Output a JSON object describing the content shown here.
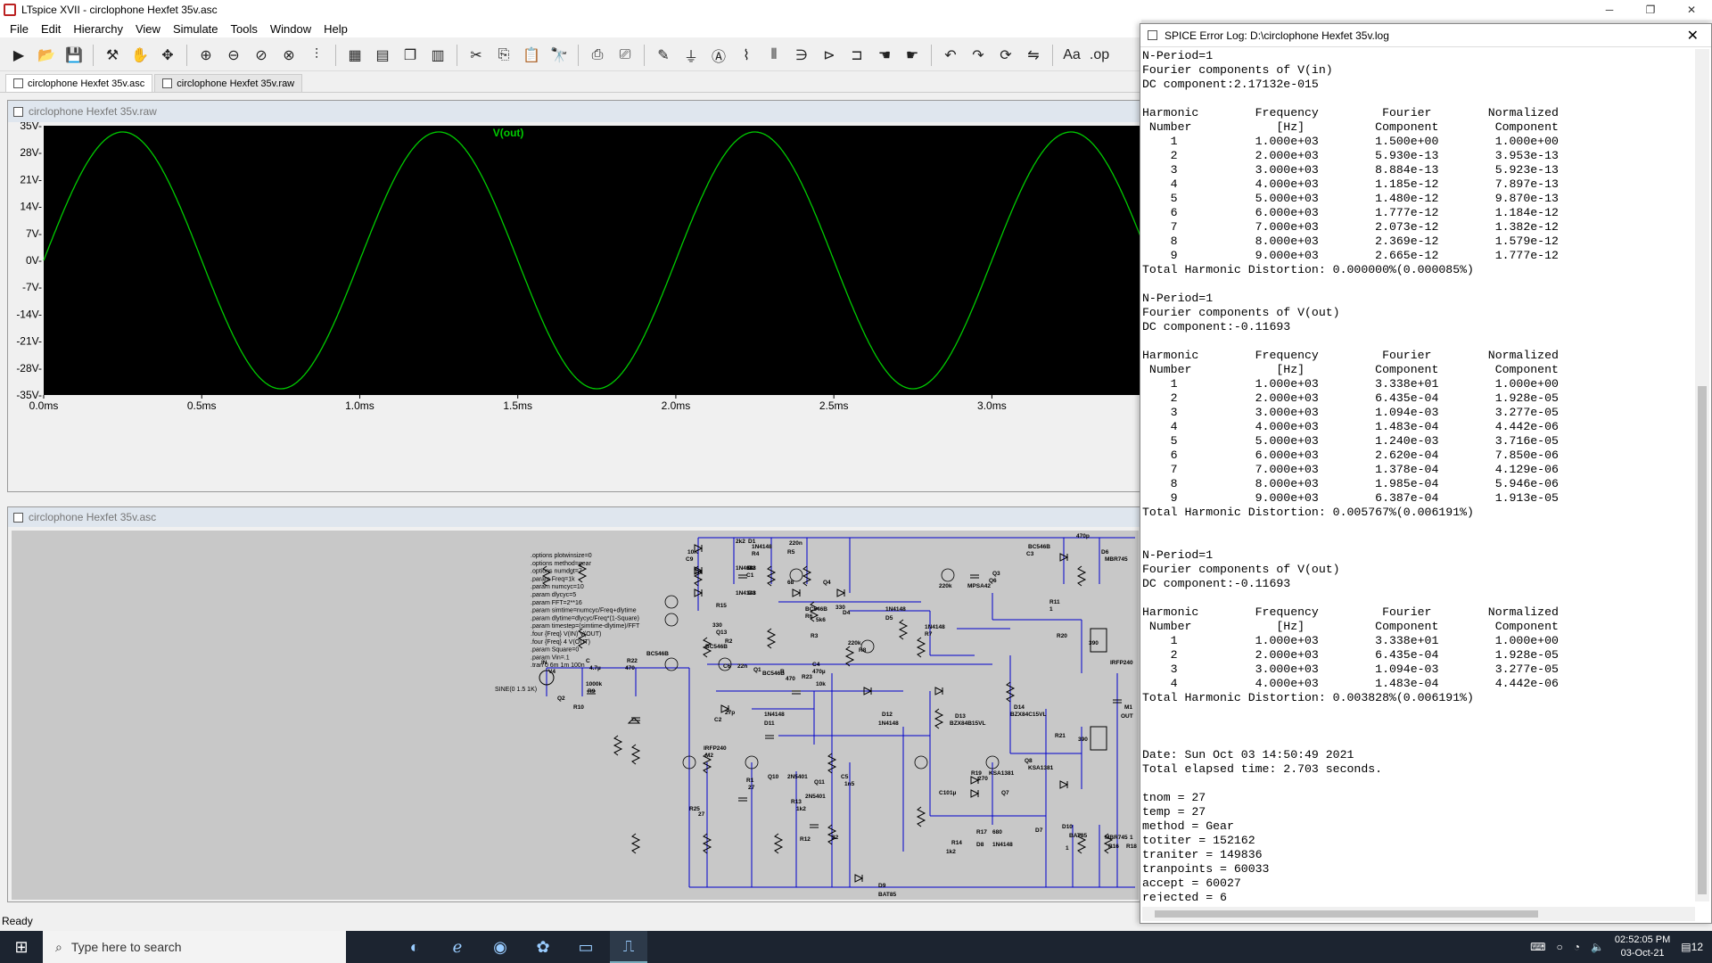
{
  "window": {
    "title": "LTspice XVII - circlophone Hexfet 35v.asc"
  },
  "menu": [
    "File",
    "Edit",
    "Hierarchy",
    "View",
    "Simulate",
    "Tools",
    "Window",
    "Help"
  ],
  "toolbar_icons": [
    "run-icon",
    "open-icon",
    "save-icon",
    "control-panel-icon",
    "halt-icon",
    "pan-icon",
    "zoom-in-icon",
    "zoom-out-icon",
    "zoom-back-icon",
    "zoom-full-icon",
    "autoscale-icon",
    "grid-icon",
    "tile-horizontal-icon",
    "cascade-icon",
    "tile-vertical-icon",
    "cut-icon",
    "copy-icon",
    "paste-icon",
    "find-icon",
    "print-icon",
    "print-preview-icon",
    "wire-icon",
    "ground-icon",
    "label-icon",
    "resistor-icon",
    "capacitor-icon",
    "inductor-icon",
    "diode-icon",
    "component-icon",
    "move-icon",
    "drag-icon",
    "undo-icon",
    "redo-icon",
    "rotate-icon",
    "mirror-icon",
    "text-icon",
    "spice-directive-icon"
  ],
  "tabs": [
    {
      "label": "circlophone Hexfet 35v.asc",
      "active": true
    },
    {
      "label": "circlophone Hexfet 35v.raw",
      "active": false
    }
  ],
  "waveform": {
    "window_title": "circlophone Hexfet 35v.raw",
    "trace_label": "V(out)",
    "trace_color": "#00cc00",
    "y_ticks": [
      "35V-",
      "28V-",
      "21V-",
      "14V-",
      "7V-",
      "0V-",
      "-7V-",
      "-14V-",
      "-21V-",
      "-28V-",
      "-35V-"
    ],
    "x_ticks": [
      "0.0ms",
      "0.5ms",
      "1.0ms",
      "1.5ms",
      "2.0ms",
      "2.5ms",
      "3.0ms"
    ]
  },
  "chart_data": {
    "type": "line",
    "title": "",
    "xlabel": "",
    "ylabel": "",
    "xlim": [
      0,
      3.47
    ],
    "ylim": [
      -35,
      35
    ],
    "x_unit": "ms",
    "y_unit": "V",
    "series": [
      {
        "name": "V(out)",
        "amplitude": 33.38,
        "frequency_khz": 1.0,
        "phase_deg": 0
      }
    ]
  },
  "schematic": {
    "window_title": "circlophone Hexfet 35v.asc",
    "directives": [
      ".options plotwinsize=0",
      ".options method=gear",
      ".options numdgt=7",
      ".param Freq=1k",
      ".param numcyc=10",
      ".param dlycyc=5",
      ".param FFT=2**16",
      ".param simtime=numcyc/Freq+dlytime",
      ".param dlytime=dlycyc/Freq*(1-Square)",
      ".param timestep=(simtime-dlytime)/FFT",
      ".four {Freq} V(IN) V(OUT)",
      ".four {Freq} 4 V(OUT)",
      ".param Square=0",
      ".param Vin=.1",
      ".tran 0 6m 1m 100n"
    ],
    "source_label": "SINE(0 1.5 1K)",
    "labels": [
      "IN",
      "V4",
      "C",
      "4.7µ",
      "R22",
      "470",
      "BC546B",
      "Q2",
      "R10",
      "1000k",
      "R9",
      "10K",
      "C9",
      "1n",
      "R15",
      "330",
      "Q13",
      "BC546B",
      "R2",
      "2k2",
      "D1",
      "1N4148",
      "D2",
      "1N4148",
      "D3",
      "1N4148",
      "R4",
      "68",
      "C1",
      "220n",
      "R5",
      "68",
      "Q4",
      "BC546B",
      "R6",
      "5k6",
      "R3",
      "330",
      "D4",
      "1N4148",
      "D5",
      "1N4148",
      "R7",
      "220k",
      "R8",
      "220k",
      "MPSA42",
      "Q3",
      "Q6",
      "BC546B",
      "C3",
      "470p",
      "D6",
      "MBR745",
      "R11",
      "1",
      "R20",
      "390",
      "IRFP240",
      "M1",
      "OUT",
      "C6",
      "22n",
      "Q1",
      "BC546B",
      "R",
      "470",
      "C4",
      "470µ",
      "R23",
      "10k",
      "C2",
      "27p",
      "1N4148",
      "D11",
      "D12",
      "1N4148",
      "D13",
      "BZX84B15VL",
      "D14",
      "BZX84C15VL",
      "R21",
      "390",
      "IRFP240",
      "M2",
      "R1",
      "27",
      "C5",
      "1n5",
      "R19",
      "270",
      "KSA1381",
      "Q7",
      "Q8",
      "KSA1381",
      "R25",
      "27",
      "Q10",
      "2N5401",
      "Q11",
      "2N5401",
      "C10",
      "1µ",
      "R12",
      "22",
      "R13",
      "1k2",
      "R14",
      "1k2",
      "R17",
      "680",
      "D8",
      "1N4148",
      "D9",
      "BAT85",
      "D10",
      "BAT85",
      "D7",
      "MBR745",
      "R16",
      "1",
      "R18",
      "1"
    ]
  },
  "status": {
    "text": "Ready"
  },
  "log": {
    "title": "SPICE Error Log: D:\\circlophone Hexfet 35v.log",
    "lines": [
      "N-Period=1",
      "Fourier components of V(in)",
      "DC component:2.17132e-015",
      "",
      "Harmonic        Frequency         Fourier        Normalized",
      " Number            [Hz]          Component        Component",
      "    1           1.000e+03        1.500e+00        1.000e+00",
      "    2           2.000e+03        5.930e-13        3.953e-13",
      "    3           3.000e+03        8.884e-13        5.923e-13",
      "    4           4.000e+03        1.185e-12        7.897e-13",
      "    5           5.000e+03        1.480e-12        9.870e-13",
      "    6           6.000e+03        1.777e-12        1.184e-12",
      "    7           7.000e+03        2.073e-12        1.382e-12",
      "    8           8.000e+03        2.369e-12        1.579e-12",
      "    9           9.000e+03        2.665e-12        1.777e-12",
      "Total Harmonic Distortion: 0.000000%(0.000085%)",
      "",
      "N-Period=1",
      "Fourier components of V(out)",
      "DC component:-0.11693",
      "",
      "Harmonic        Frequency         Fourier        Normalized",
      " Number            [Hz]          Component        Component",
      "    1           1.000e+03        3.338e+01        1.000e+00",
      "    2           2.000e+03        6.435e-04        1.928e-05",
      "    3           3.000e+03        1.094e-03        3.277e-05",
      "    4           4.000e+03        1.483e-04        4.442e-06",
      "    5           5.000e+03        1.240e-03        3.716e-05",
      "    6           6.000e+03        2.620e-04        7.850e-06",
      "    7           7.000e+03        1.378e-04        4.129e-06",
      "    8           8.000e+03        1.985e-04        5.946e-06",
      "    9           9.000e+03        6.387e-04        1.913e-05",
      "Total Harmonic Distortion: 0.005767%(0.006191%)",
      "",
      "",
      "N-Period=1",
      "Fourier components of V(out)",
      "DC component:-0.11693",
      "",
      "Harmonic        Frequency         Fourier        Normalized",
      " Number            [Hz]          Component        Component",
      "    1           1.000e+03        3.338e+01        1.000e+00",
      "    2           2.000e+03        6.435e-04        1.928e-05",
      "    3           3.000e+03        1.094e-03        3.277e-05",
      "    4           4.000e+03        1.483e-04        4.442e-06",
      "Total Harmonic Distortion: 0.003828%(0.006191%)",
      "",
      "",
      "",
      "Date: Sun Oct 03 14:50:49 2021",
      "Total elapsed time: 2.703 seconds.",
      "",
      "tnom = 27",
      "temp = 27",
      "method = Gear",
      "totiter = 152162",
      "traniter = 149836",
      "tranpoints = 60033",
      "accept = 60027",
      "rejected = 6"
    ]
  },
  "taskbar": {
    "search_placeholder": "Type here to search",
    "time": "02:52:05 PM",
    "date": "03-Oct-21",
    "notification_count": "12"
  }
}
